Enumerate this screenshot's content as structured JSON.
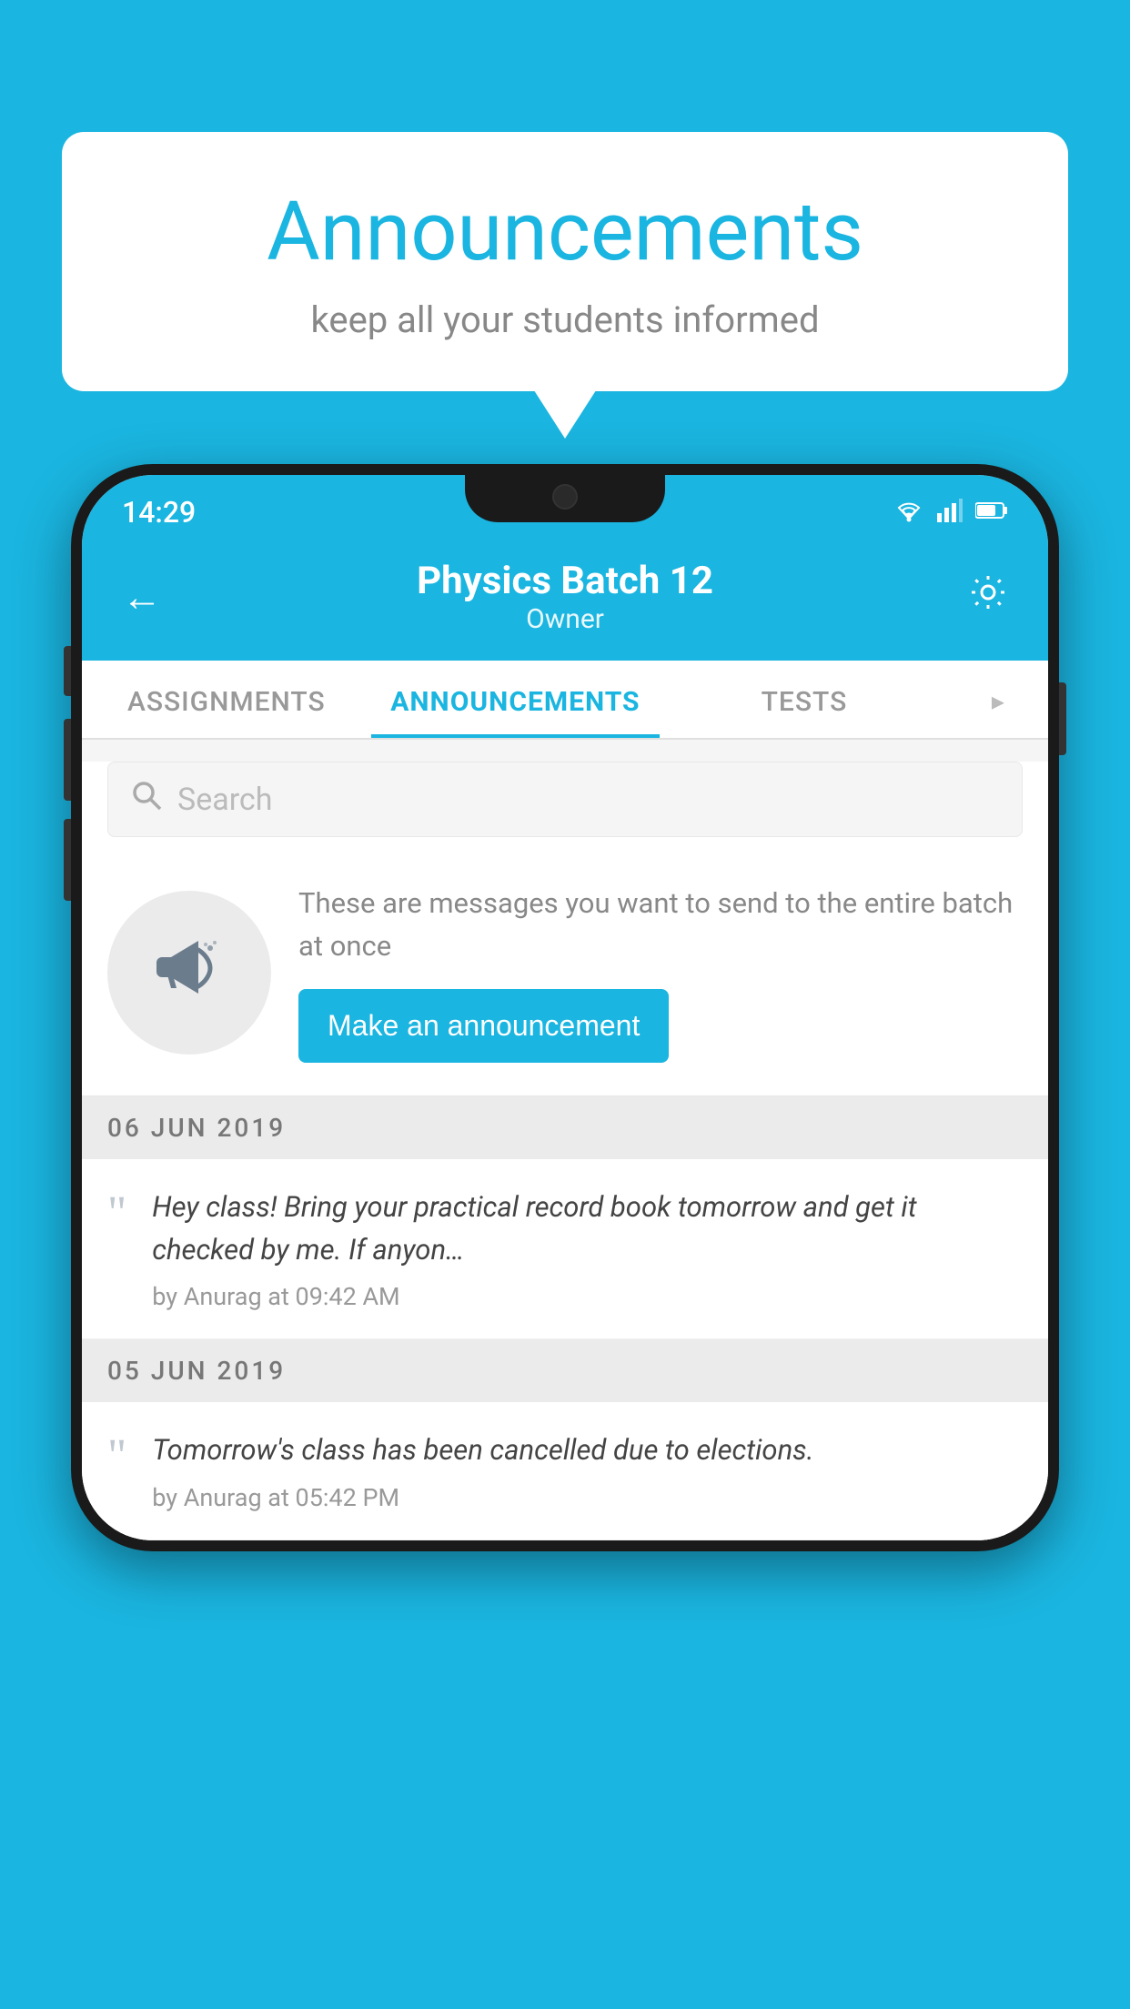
{
  "page": {
    "background_color": "#1ab5e0"
  },
  "speech_bubble": {
    "title": "Announcements",
    "subtitle": "keep all your students informed"
  },
  "phone": {
    "status_bar": {
      "time": "14:29",
      "wifi": "▾",
      "signal": "▲",
      "battery": "▮"
    },
    "header": {
      "back_label": "←",
      "title": "Physics Batch 12",
      "subtitle": "Owner",
      "settings_label": "⚙"
    },
    "tabs": [
      {
        "label": "ASSIGNMENTS",
        "active": false
      },
      {
        "label": "ANNOUNCEMENTS",
        "active": true
      },
      {
        "label": "TESTS",
        "active": false
      },
      {
        "label": "•",
        "active": false
      }
    ],
    "search": {
      "placeholder": "Search"
    },
    "announcement_prompt": {
      "description": "These are messages you want to send to the entire batch at once",
      "button_label": "Make an announcement"
    },
    "announcements": [
      {
        "date": "06  JUN  2019",
        "text": "Hey class! Bring your practical record book tomorrow and get it checked by me. If anyon…",
        "meta": "by Anurag at 09:42 AM"
      },
      {
        "date": "05  JUN  2019",
        "text": "Tomorrow's class has been cancelled due to elections.",
        "meta": "by Anurag at 05:42 PM"
      }
    ]
  }
}
